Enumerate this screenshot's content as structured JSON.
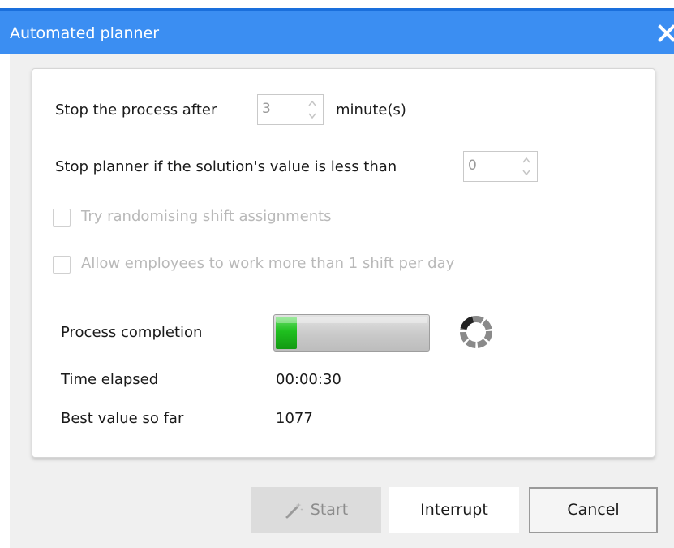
{
  "window": {
    "title": "Automated planner",
    "accent_color": "#3b8ef2"
  },
  "settings": {
    "stop_after_label": "Stop the process after",
    "stop_after_value": "3",
    "stop_after_unit": "minute(s)",
    "stop_value_label": "Stop planner if the solution's value is less than",
    "stop_value_value": "0"
  },
  "options": [
    {
      "label": "Try randomising shift assignments",
      "checked": false,
      "enabled": false
    },
    {
      "label": "Allow employees to work more than 1 shift per day",
      "checked": false,
      "enabled": false
    }
  ],
  "status": {
    "completion_label": "Process completion",
    "completion_fraction": 0.14,
    "completion_color": "#1fbf1f",
    "spinner_icon": "loading-spinner-icon",
    "time_label": "Time elapsed",
    "time_value": "00:00:30",
    "best_label": "Best value so far",
    "best_value": "1077"
  },
  "buttons": {
    "start": "Start",
    "start_enabled": false,
    "start_icon": "magic-wand-icon",
    "interrupt": "Interrupt",
    "cancel": "Cancel"
  }
}
